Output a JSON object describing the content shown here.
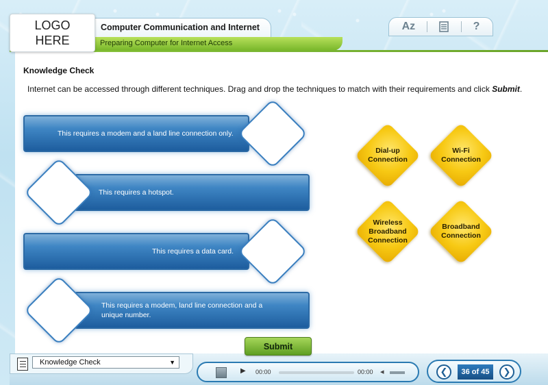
{
  "header": {
    "logo_text": "LOGO\nHERE",
    "course_title": "Computer Communication and Internet",
    "module_subtitle": "Preparing Computer for Internet Access",
    "tools": {
      "glossary_label": "Az",
      "help_label": "?"
    }
  },
  "content": {
    "heading": "Knowledge Check",
    "instruction_text": "Internet can be accessed through different techniques. Drag and drop the techniques to match with their requirements and click ",
    "instruction_emphasis": "Submit",
    "instruction_end": ".",
    "requirements": [
      "This requires a modem and a land line connection only.",
      "This requires a hotspot.",
      "This requires a data card.",
      "This requires a modem, land line connection and a unique number."
    ],
    "answers": [
      "Dial-up\nConnection",
      "Wi-Fi\nConnection",
      "Wireless\nBroadband\nConnection",
      "Broadband\nConnection"
    ],
    "submit_label": "Submit"
  },
  "footer": {
    "topic_select_value": "Knowledge Check",
    "time_current": "00:00",
    "time_total": "00:00",
    "page_counter": "36 of 45",
    "prev_label": "❮",
    "next_label": "❯"
  },
  "colors": {
    "accent_blue": "#2a7ab2",
    "accent_green": "#8cc63f",
    "answer_yellow": "#f7c914"
  },
  "icons": {
    "glossary": "az-icon",
    "transcript": "document-icon",
    "help": "question-icon",
    "menu": "menu-list-icon",
    "play": "play-icon",
    "volume": "volume-icon"
  }
}
